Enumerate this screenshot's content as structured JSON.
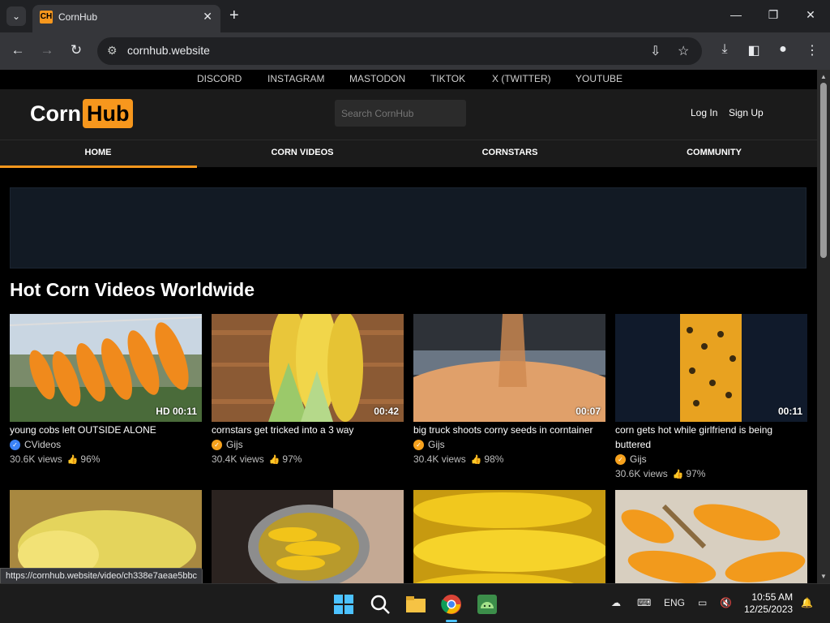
{
  "browser": {
    "tab_title": "CornHub",
    "favicon_text": "CH",
    "url": "cornhub.website",
    "status_url": "https://cornhub.website/video/ch338e7aeae5bbc"
  },
  "site": {
    "social_links": [
      "DISCORD",
      "INSTAGRAM",
      "MASTODON",
      "TIKTOK",
      "X (TWITTER)",
      "YOUTUBE"
    ],
    "logo_left": "Corn",
    "logo_right": "Hub",
    "search_placeholder": "Search CornHub",
    "login": "Log In",
    "signup": "Sign Up",
    "nav": [
      "HOME",
      "CORN VIDEOS",
      "CORNSTARS",
      "COMMUNITY"
    ],
    "accent_color": "#f7971d",
    "section_title": "Hot Corn Videos Worldwide"
  },
  "videos": [
    {
      "title": "young cobs left OUTSIDE ALONE",
      "channel": "CVideos",
      "badge_color": "#3b82f6",
      "views": "30.6K views",
      "rating": "96%",
      "duration": "HD 00:11"
    },
    {
      "title": "cornstars get tricked into a 3 way",
      "channel": "Gijs",
      "badge_color": "#f7a21d",
      "views": "30.4K views",
      "rating": "97%",
      "duration": "00:42"
    },
    {
      "title": "big truck shoots corny seeds in corntainer",
      "channel": "Gijs",
      "badge_color": "#f7a21d",
      "views": "30.4K views",
      "rating": "98%",
      "duration": "00:07"
    },
    {
      "title": "corn gets hot while girlfriend is being buttered",
      "channel": "Gijs",
      "badge_color": "#f7a21d",
      "views": "30.6K views",
      "rating": "97%",
      "duration": "00:11"
    }
  ],
  "taskbar": {
    "lang": "ENG",
    "time": "10:55 AM",
    "date": "12/25/2023"
  }
}
